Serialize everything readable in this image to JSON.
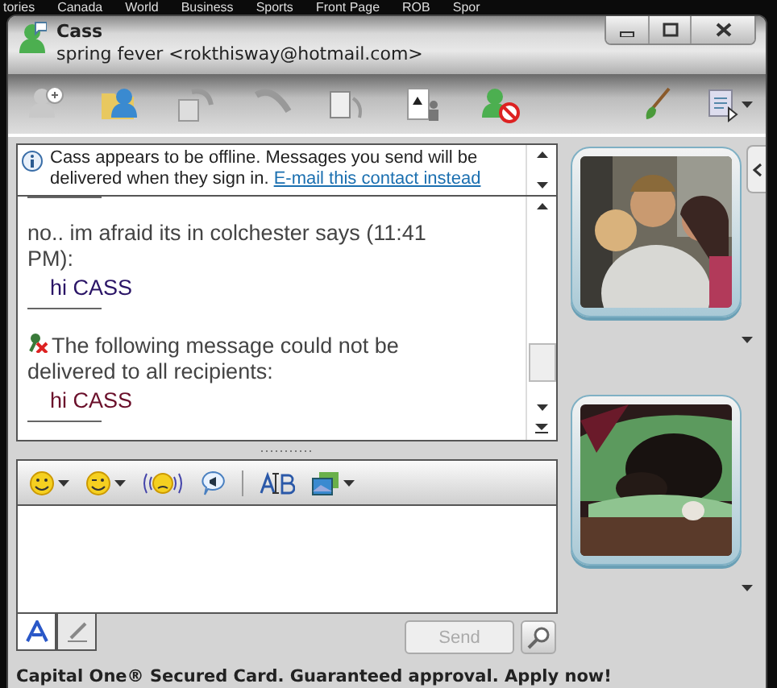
{
  "backdrop": {
    "links": [
      "tories",
      "Canada",
      "World",
      "Business",
      "Sports",
      "Front Page",
      "ROB",
      "Spor"
    ]
  },
  "window": {
    "contact_name": "Cass",
    "contact_status": "spring fever <rokthisway@hotmail.com>"
  },
  "info_bar": {
    "text": "Cass appears to be offline. Messages you send will be delivered when they sign in.",
    "link": "E-mail this contact instead"
  },
  "messages": [
    {
      "kind": "message",
      "sender_line": "no.. im afraid its in colchester says (11:41 PM):",
      "body": "hi CASS"
    },
    {
      "kind": "error",
      "notice": "The following message could not be delivered to all recipients:",
      "body": "hi CASS"
    }
  ],
  "send_button": {
    "label": "Send",
    "disabled": true
  },
  "ad": "Capital One® Secured Card. Guaranteed approval. Apply now!"
}
